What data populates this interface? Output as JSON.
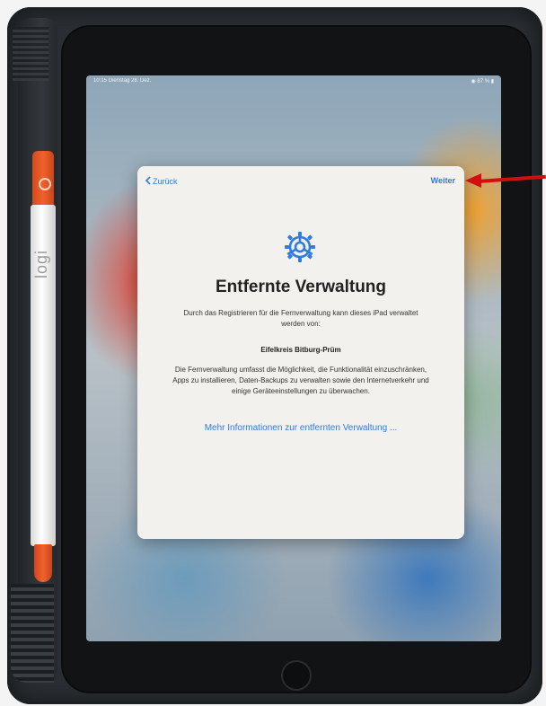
{
  "statusbar": {
    "time": "10:15  Dienstag 28. Dez.",
    "right": "◉ 87 % ▮"
  },
  "pencil": {
    "logo": "logi"
  },
  "setup": {
    "back_label": "Zurück",
    "next_label": "Weiter",
    "title": "Entfernte Verwaltung",
    "intro": "Durch das Registrieren für die Fernverwaltung kann dieses iPad verwaltet werden von:",
    "organization": "Eifelkreis Bitburg-Prüm",
    "description": "Die Fernverwaltung umfasst die Möglichkeit, die Funktionalität einzuschränken, Apps zu installieren, Daten-Backups zu verwalten sowie den Internetverkehr und einige Geräteeinstellungen zu überwachen.",
    "more_link": "Mehr Informationen zur entfernten Verwaltung ...",
    "gear_icon": "gear-icon"
  },
  "annotation": {
    "arrow": "red-arrow-pointing-to-next",
    "color": "#d10f0f"
  },
  "colors": {
    "accent": "#2f7be0",
    "sheet": "#f3f1ed"
  }
}
